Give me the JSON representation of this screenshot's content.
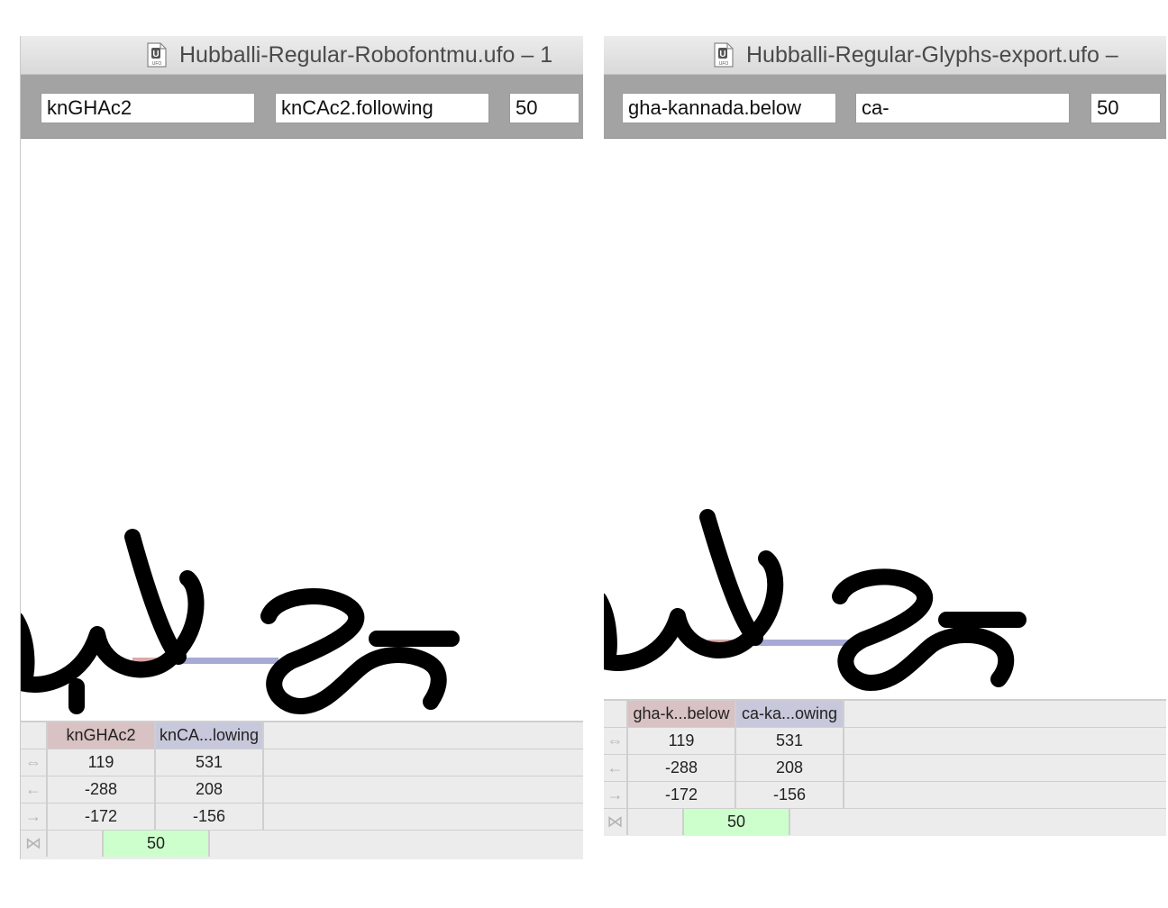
{
  "left_window": {
    "title": "Hubballi-Regular-Robofontmu.ufo – 1",
    "icon": "ufo-file-icon",
    "fields": {
      "left_glyph": "knGHAc2",
      "right_glyph": "knCAc2.following",
      "kerning": "50"
    },
    "table": {
      "headers": [
        "knGHAc2",
        "knCA...lowing"
      ],
      "rows": [
        {
          "icon": "width-arrows-icon",
          "values": [
            "119",
            "531"
          ]
        },
        {
          "icon": "left-arrow-icon",
          "values": [
            "-288",
            "208"
          ]
        },
        {
          "icon": "right-arrow-icon",
          "values": [
            "-172",
            "-156"
          ]
        }
      ],
      "kerning_icon": "kerning-bowtie-icon",
      "kerning_value": "50"
    }
  },
  "right_window": {
    "title": "Hubballi-Regular-Glyphs-export.ufo –",
    "icon": "ufo-file-icon",
    "fields": {
      "left_glyph": "gha-kannada.below",
      "right_glyph": "ca-",
      "kerning": "50"
    },
    "table": {
      "headers": [
        "gha-k...below",
        "ca-ka...owing"
      ],
      "rows": [
        {
          "icon": "width-arrows-icon",
          "values": [
            "119",
            "531"
          ]
        },
        {
          "icon": "left-arrow-icon",
          "values": [
            "-288",
            "208"
          ]
        },
        {
          "icon": "right-arrow-icon",
          "values": [
            "-172",
            "-156"
          ]
        }
      ],
      "kerning_icon": "kerning-bowtie-icon",
      "kerning_value": "50"
    }
  },
  "colors": {
    "left_glyph_marker": "#d9a9a9",
    "right_glyph_marker": "#a9a9d6",
    "kerning_cell": "#ccffcc",
    "toolbar": "#a3a3a3"
  }
}
